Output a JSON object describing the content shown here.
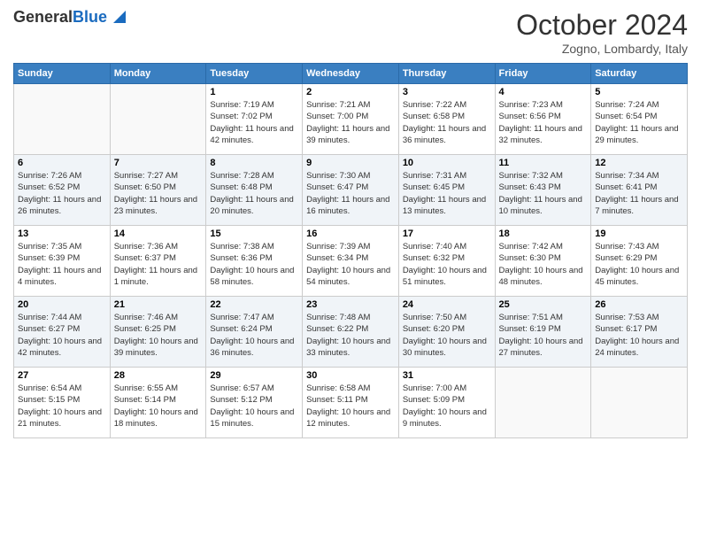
{
  "header": {
    "logo_general": "General",
    "logo_blue": "Blue",
    "month_title": "October 2024",
    "location": "Zogno, Lombardy, Italy"
  },
  "weekdays": [
    "Sunday",
    "Monday",
    "Tuesday",
    "Wednesday",
    "Thursday",
    "Friday",
    "Saturday"
  ],
  "weeks": [
    [
      {
        "day": "",
        "sunrise": "",
        "sunset": "",
        "daylight": ""
      },
      {
        "day": "",
        "sunrise": "",
        "sunset": "",
        "daylight": ""
      },
      {
        "day": "1",
        "sunrise": "Sunrise: 7:19 AM",
        "sunset": "Sunset: 7:02 PM",
        "daylight": "Daylight: 11 hours and 42 minutes."
      },
      {
        "day": "2",
        "sunrise": "Sunrise: 7:21 AM",
        "sunset": "Sunset: 7:00 PM",
        "daylight": "Daylight: 11 hours and 39 minutes."
      },
      {
        "day": "3",
        "sunrise": "Sunrise: 7:22 AM",
        "sunset": "Sunset: 6:58 PM",
        "daylight": "Daylight: 11 hours and 36 minutes."
      },
      {
        "day": "4",
        "sunrise": "Sunrise: 7:23 AM",
        "sunset": "Sunset: 6:56 PM",
        "daylight": "Daylight: 11 hours and 32 minutes."
      },
      {
        "day": "5",
        "sunrise": "Sunrise: 7:24 AM",
        "sunset": "Sunset: 6:54 PM",
        "daylight": "Daylight: 11 hours and 29 minutes."
      }
    ],
    [
      {
        "day": "6",
        "sunrise": "Sunrise: 7:26 AM",
        "sunset": "Sunset: 6:52 PM",
        "daylight": "Daylight: 11 hours and 26 minutes."
      },
      {
        "day": "7",
        "sunrise": "Sunrise: 7:27 AM",
        "sunset": "Sunset: 6:50 PM",
        "daylight": "Daylight: 11 hours and 23 minutes."
      },
      {
        "day": "8",
        "sunrise": "Sunrise: 7:28 AM",
        "sunset": "Sunset: 6:48 PM",
        "daylight": "Daylight: 11 hours and 20 minutes."
      },
      {
        "day": "9",
        "sunrise": "Sunrise: 7:30 AM",
        "sunset": "Sunset: 6:47 PM",
        "daylight": "Daylight: 11 hours and 16 minutes."
      },
      {
        "day": "10",
        "sunrise": "Sunrise: 7:31 AM",
        "sunset": "Sunset: 6:45 PM",
        "daylight": "Daylight: 11 hours and 13 minutes."
      },
      {
        "day": "11",
        "sunrise": "Sunrise: 7:32 AM",
        "sunset": "Sunset: 6:43 PM",
        "daylight": "Daylight: 11 hours and 10 minutes."
      },
      {
        "day": "12",
        "sunrise": "Sunrise: 7:34 AM",
        "sunset": "Sunset: 6:41 PM",
        "daylight": "Daylight: 11 hours and 7 minutes."
      }
    ],
    [
      {
        "day": "13",
        "sunrise": "Sunrise: 7:35 AM",
        "sunset": "Sunset: 6:39 PM",
        "daylight": "Daylight: 11 hours and 4 minutes."
      },
      {
        "day": "14",
        "sunrise": "Sunrise: 7:36 AM",
        "sunset": "Sunset: 6:37 PM",
        "daylight": "Daylight: 11 hours and 1 minute."
      },
      {
        "day": "15",
        "sunrise": "Sunrise: 7:38 AM",
        "sunset": "Sunset: 6:36 PM",
        "daylight": "Daylight: 10 hours and 58 minutes."
      },
      {
        "day": "16",
        "sunrise": "Sunrise: 7:39 AM",
        "sunset": "Sunset: 6:34 PM",
        "daylight": "Daylight: 10 hours and 54 minutes."
      },
      {
        "day": "17",
        "sunrise": "Sunrise: 7:40 AM",
        "sunset": "Sunset: 6:32 PM",
        "daylight": "Daylight: 10 hours and 51 minutes."
      },
      {
        "day": "18",
        "sunrise": "Sunrise: 7:42 AM",
        "sunset": "Sunset: 6:30 PM",
        "daylight": "Daylight: 10 hours and 48 minutes."
      },
      {
        "day": "19",
        "sunrise": "Sunrise: 7:43 AM",
        "sunset": "Sunset: 6:29 PM",
        "daylight": "Daylight: 10 hours and 45 minutes."
      }
    ],
    [
      {
        "day": "20",
        "sunrise": "Sunrise: 7:44 AM",
        "sunset": "Sunset: 6:27 PM",
        "daylight": "Daylight: 10 hours and 42 minutes."
      },
      {
        "day": "21",
        "sunrise": "Sunrise: 7:46 AM",
        "sunset": "Sunset: 6:25 PM",
        "daylight": "Daylight: 10 hours and 39 minutes."
      },
      {
        "day": "22",
        "sunrise": "Sunrise: 7:47 AM",
        "sunset": "Sunset: 6:24 PM",
        "daylight": "Daylight: 10 hours and 36 minutes."
      },
      {
        "day": "23",
        "sunrise": "Sunrise: 7:48 AM",
        "sunset": "Sunset: 6:22 PM",
        "daylight": "Daylight: 10 hours and 33 minutes."
      },
      {
        "day": "24",
        "sunrise": "Sunrise: 7:50 AM",
        "sunset": "Sunset: 6:20 PM",
        "daylight": "Daylight: 10 hours and 30 minutes."
      },
      {
        "day": "25",
        "sunrise": "Sunrise: 7:51 AM",
        "sunset": "Sunset: 6:19 PM",
        "daylight": "Daylight: 10 hours and 27 minutes."
      },
      {
        "day": "26",
        "sunrise": "Sunrise: 7:53 AM",
        "sunset": "Sunset: 6:17 PM",
        "daylight": "Daylight: 10 hours and 24 minutes."
      }
    ],
    [
      {
        "day": "27",
        "sunrise": "Sunrise: 6:54 AM",
        "sunset": "Sunset: 5:15 PM",
        "daylight": "Daylight: 10 hours and 21 minutes."
      },
      {
        "day": "28",
        "sunrise": "Sunrise: 6:55 AM",
        "sunset": "Sunset: 5:14 PM",
        "daylight": "Daylight: 10 hours and 18 minutes."
      },
      {
        "day": "29",
        "sunrise": "Sunrise: 6:57 AM",
        "sunset": "Sunset: 5:12 PM",
        "daylight": "Daylight: 10 hours and 15 minutes."
      },
      {
        "day": "30",
        "sunrise": "Sunrise: 6:58 AM",
        "sunset": "Sunset: 5:11 PM",
        "daylight": "Daylight: 10 hours and 12 minutes."
      },
      {
        "day": "31",
        "sunrise": "Sunrise: 7:00 AM",
        "sunset": "Sunset: 5:09 PM",
        "daylight": "Daylight: 10 hours and 9 minutes."
      },
      {
        "day": "",
        "sunrise": "",
        "sunset": "",
        "daylight": ""
      },
      {
        "day": "",
        "sunrise": "",
        "sunset": "",
        "daylight": ""
      }
    ]
  ]
}
